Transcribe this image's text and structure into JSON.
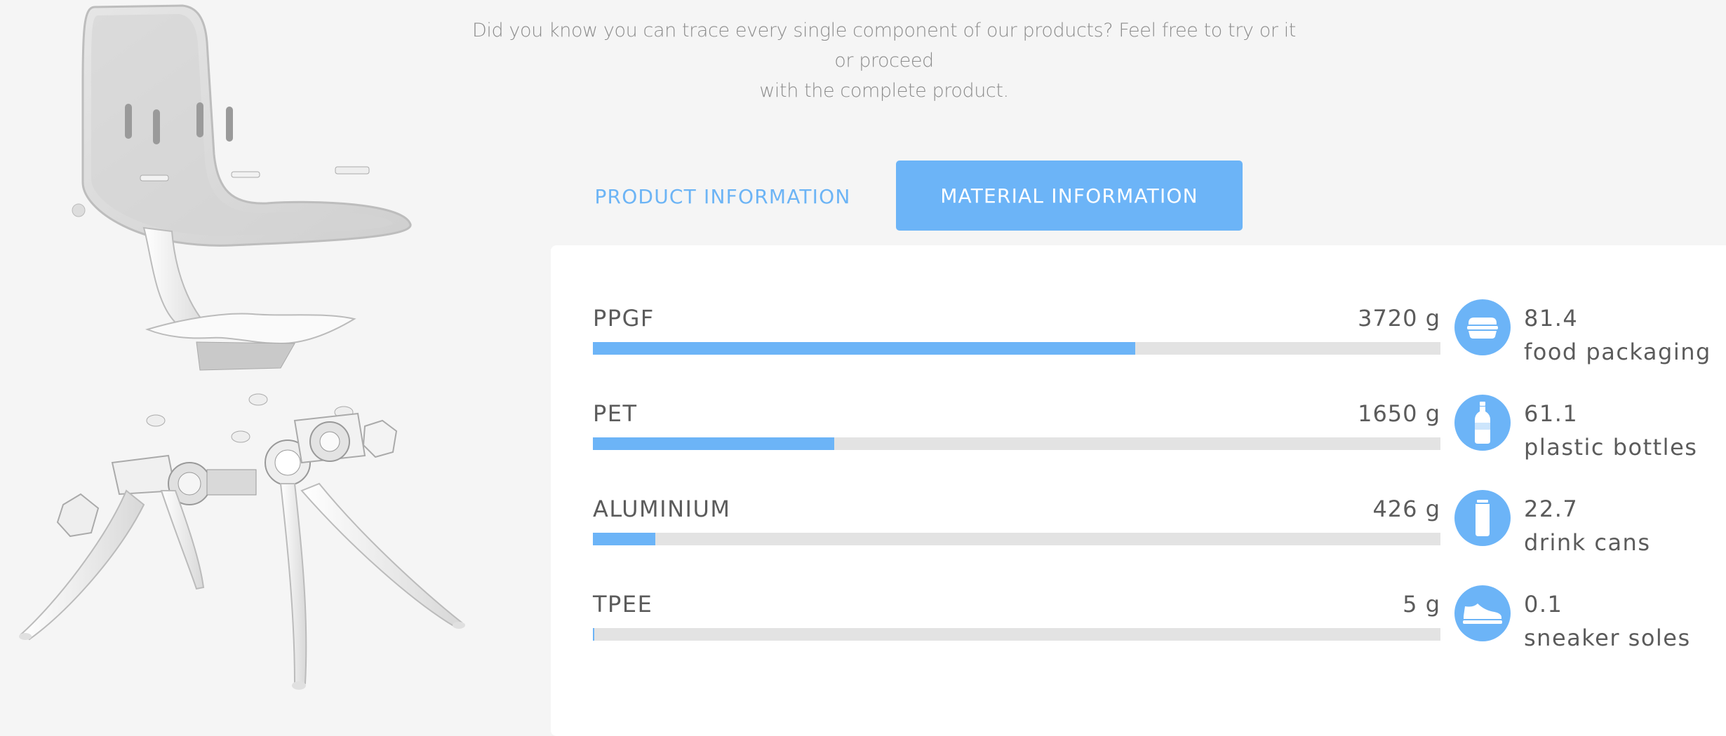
{
  "intro": {
    "line1": "Did you know you can trace every single component of our products? Feel free to try or it or proceed",
    "line2": "with the complete product."
  },
  "tabs": {
    "product": "PRODUCT INFORMATION",
    "material": "MATERIAL INFORMATION",
    "active": "material"
  },
  "colors": {
    "accent": "#6cb4f7",
    "track": "#e3e3e3",
    "text": "#5b5b5b"
  },
  "materials": [
    {
      "name": "PPGF",
      "weight": "3720 g",
      "fill_fraction": 0.64,
      "icon": "food-container-icon",
      "equivalent_value": "81.4",
      "equivalent_label": "food packaging"
    },
    {
      "name": "PET",
      "weight": "1650 g",
      "fill_fraction": 0.285,
      "icon": "bottle-icon",
      "equivalent_value": "61.1",
      "equivalent_label": "plastic bottles"
    },
    {
      "name": "ALUMINIUM",
      "weight": "426 g",
      "fill_fraction": 0.074,
      "icon": "drink-can-icon",
      "equivalent_value": "22.7",
      "equivalent_label": "drink cans"
    },
    {
      "name": "TPEE",
      "weight": "5 g",
      "fill_fraction": 0.002,
      "icon": "sneaker-icon",
      "equivalent_value": "0.1",
      "equivalent_label": "sneaker soles"
    }
  ]
}
